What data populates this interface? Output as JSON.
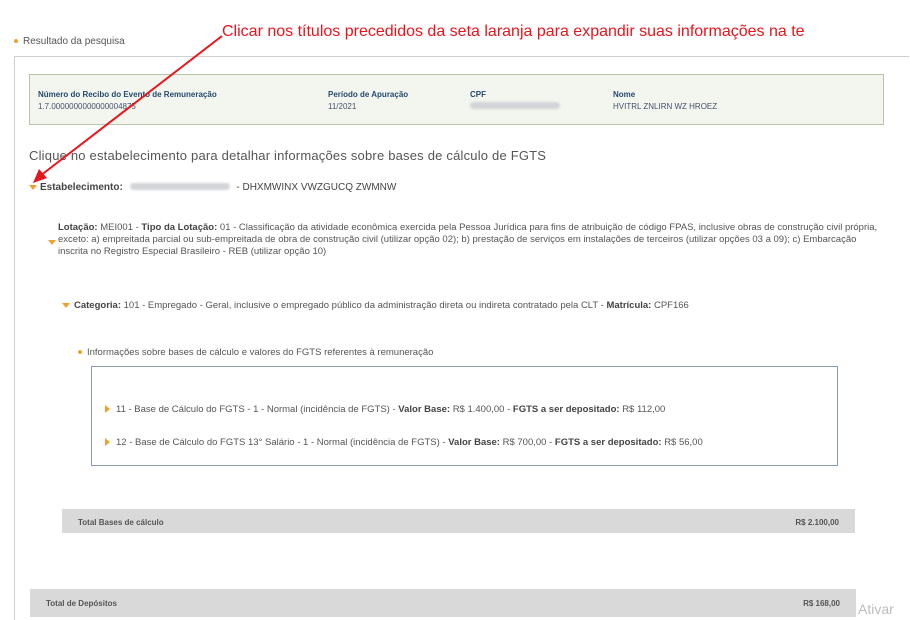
{
  "result_label": "Resultado da pesquisa",
  "annotation": "Clicar nos títulos precedidos da seta laranja para expandir suas informações na te",
  "summary": {
    "recibo_header": "Número do Recibo do Evento de Remuneração",
    "recibo_value": "1.7.0000000000000004875",
    "periodo_header": "Período de Apuração",
    "periodo_value": "11/2021",
    "cpf_header": "CPF",
    "nome_header": "Nome",
    "nome_value": "HVITRL ZNLIRN WZ HROEZ"
  },
  "instruction": "Clique no estabelecimento para detalhar informações sobre bases de cálculo de FGTS",
  "estabelecimento": {
    "label": "Estabelecimento:",
    "name": "- DHXMWINX VWZGUCQ ZWMNW"
  },
  "lotacao": {
    "label": "Lotação:",
    "code": "MEI001 -",
    "tipo_label": "Tipo da Lotação:",
    "tipo_text": "01 - Classificação da atividade econômica exercida pela Pessoa Jurídica para fins de atribuição de código FPAS, inclusive obras de construção civil própria, exceto: a) empreitada parcial ou sub-empreitada de obra de construção civil (utilizar opção 02); b) prestação de serviços em instalações de terceiros (utilizar opções 03 a 09); c) Embarcação inscrita no Registro Especial Brasileiro - REB (utilizar opção 10)"
  },
  "categoria": {
    "label": "Categoria:",
    "text": "101 - Empregado - Geral, inclusive o empregado público da administração direta ou indireta contratado pela CLT -",
    "matricula_label": "Matrícula:",
    "matricula_value": "CPF166"
  },
  "info_title": "Informações sobre bases de cálculo e valores do FGTS referentes à remuneração",
  "bases": [
    {
      "text": "11 - Base de Cálculo do FGTS - 1 - Normal (incidência de FGTS) -",
      "valor_label": "Valor Base:",
      "valor": "R$ 1.400,00 -",
      "fgts_label": "FGTS a ser depositado:",
      "fgts": "R$ 112,00"
    },
    {
      "text": "12 - Base de Cálculo do FGTS 13° Salário - 1 - Normal (incidência de FGTS) -",
      "valor_label": "Valor Base:",
      "valor": "R$ 700,00 -",
      "fgts_label": "FGTS a ser depositado:",
      "fgts": "R$ 56,00"
    }
  ],
  "total_bases": {
    "label": "Total Bases de cálculo",
    "value": "R$ 2.100,00"
  },
  "total_depositos": {
    "label": "Total de Depósitos",
    "value": "R$ 168,00"
  },
  "watermark": "Ativar",
  "colors": {
    "arrow": "#e8151c",
    "accent": "#f0a030"
  }
}
